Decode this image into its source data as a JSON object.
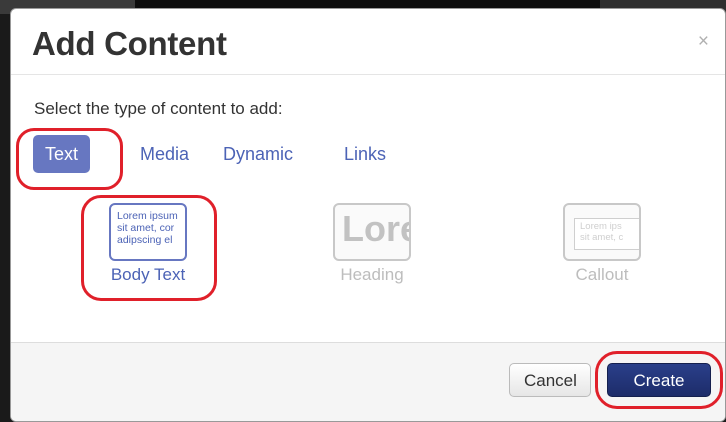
{
  "dialog": {
    "title": "Add Content",
    "close_glyph": "×",
    "prompt": "Select the type of content to add:"
  },
  "tabs": [
    {
      "label": "Text",
      "active": true
    },
    {
      "label": "Media",
      "active": false
    },
    {
      "label": "Dynamic",
      "active": false
    },
    {
      "label": "Links",
      "active": false
    }
  ],
  "content_types": [
    {
      "label": "Body Text",
      "selected": true,
      "thumb_lines": [
        "Lorem ipsum",
        "sit amet, cor",
        "adipscing el"
      ]
    },
    {
      "label": "Heading",
      "selected": false,
      "thumb_text": "Lore"
    },
    {
      "label": "Callout",
      "selected": false,
      "thumb_lines": [
        "Lorem ips",
        "sit amet, c"
      ]
    }
  ],
  "footer": {
    "cancel_label": "Cancel",
    "create_label": "Create"
  },
  "colors": {
    "accent": "#6777c1",
    "link": "#4c63b6",
    "primary_button": "#1d2c69",
    "highlight_ring": "#e0202a"
  }
}
